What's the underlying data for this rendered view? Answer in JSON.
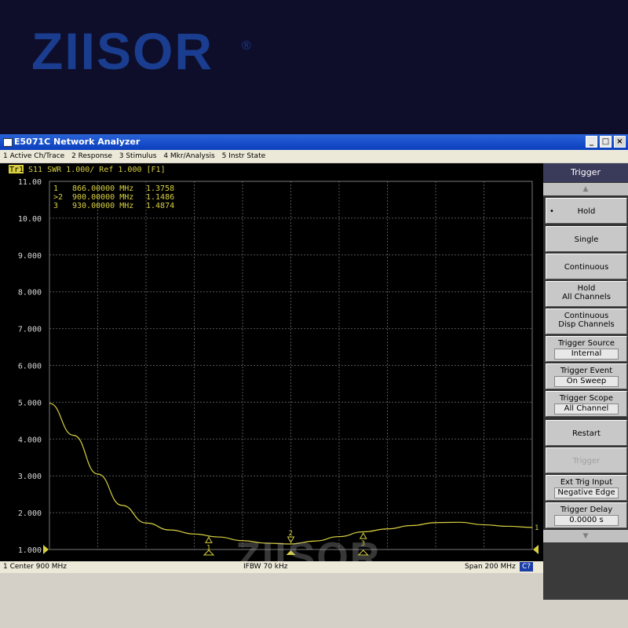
{
  "logo": {
    "text": "ZIISOR",
    "reg": "®"
  },
  "window": {
    "title": "E5071C Network Analyzer",
    "buttons": {
      "min": "_",
      "max": "□",
      "close": "×"
    }
  },
  "menu": [
    "1 Active Ch/Trace",
    "2 Response",
    "3 Stimulus",
    "4 Mkr/Analysis",
    "5 Instr State"
  ],
  "trace_header": {
    "tr": "Tr1",
    "info": "S11  SWR 1.000/ Ref 1.000 [F1]"
  },
  "markers": [
    {
      "label": " 1",
      "freq": "866.00000 MHz",
      "val": "1.3758"
    },
    {
      "label": ">2",
      "freq": "900.00000 MHz",
      "val": "1.1486"
    },
    {
      "label": " 3",
      "freq": "930.00000 MHz",
      "val": "1.4874"
    }
  ],
  "watermark": "ZIISOR",
  "status": {
    "left": "1  Center 900 MHz",
    "center": "IFBW 70 kHz",
    "right": "Span 200 MHz",
    "badge": "C?"
  },
  "softkeys": {
    "header": "Trigger",
    "up_arrow": "▲",
    "down_arrow": "▼",
    "items": [
      {
        "label": "Hold",
        "bullet": "•"
      },
      {
        "label": "Single"
      },
      {
        "label": "Continuous"
      },
      {
        "label": "Hold",
        "label2": "All Channels"
      },
      {
        "label": "Continuous",
        "label2": "Disp Channels"
      },
      {
        "label": "Trigger Source",
        "value": "Internal"
      },
      {
        "label": "Trigger Event",
        "value": "On Sweep"
      },
      {
        "label": "Trigger Scope",
        "value": "All Channel"
      },
      {
        "label": "Restart"
      },
      {
        "label": "Trigger"
      },
      {
        "label": "Ext Trig Input",
        "value": "Negative Edge"
      },
      {
        "label": "Trigger Delay",
        "value": "0.0000 s"
      }
    ]
  },
  "chart_data": {
    "type": "line",
    "ylim": [
      1,
      11
    ],
    "yticks": [
      "11.00",
      "10.00",
      "9.000",
      "8.000",
      "7.000",
      "6.000",
      "5.000",
      "4.000",
      "3.000",
      "2.000",
      "1.000"
    ],
    "xlim": [
      800,
      1000
    ],
    "x_grid_lines": 10,
    "grid": true,
    "trace_color": "#d8d040",
    "series": [
      {
        "x": [
          800,
          810,
          820,
          830,
          840,
          850,
          860,
          870,
          880,
          890,
          900,
          910,
          920,
          930,
          940,
          950,
          960,
          970,
          980,
          990,
          1000
        ],
        "values": [
          4.97,
          4.1,
          3.05,
          2.2,
          1.72,
          1.53,
          1.42,
          1.34,
          1.24,
          1.17,
          1.15,
          1.23,
          1.35,
          1.48,
          1.56,
          1.65,
          1.73,
          1.74,
          1.67,
          1.63,
          1.6
        ]
      }
    ],
    "marker_x": [
      866,
      900,
      930
    ],
    "marker_values": [
      1.3758,
      1.1486,
      1.4874
    ],
    "end_label": "1"
  }
}
